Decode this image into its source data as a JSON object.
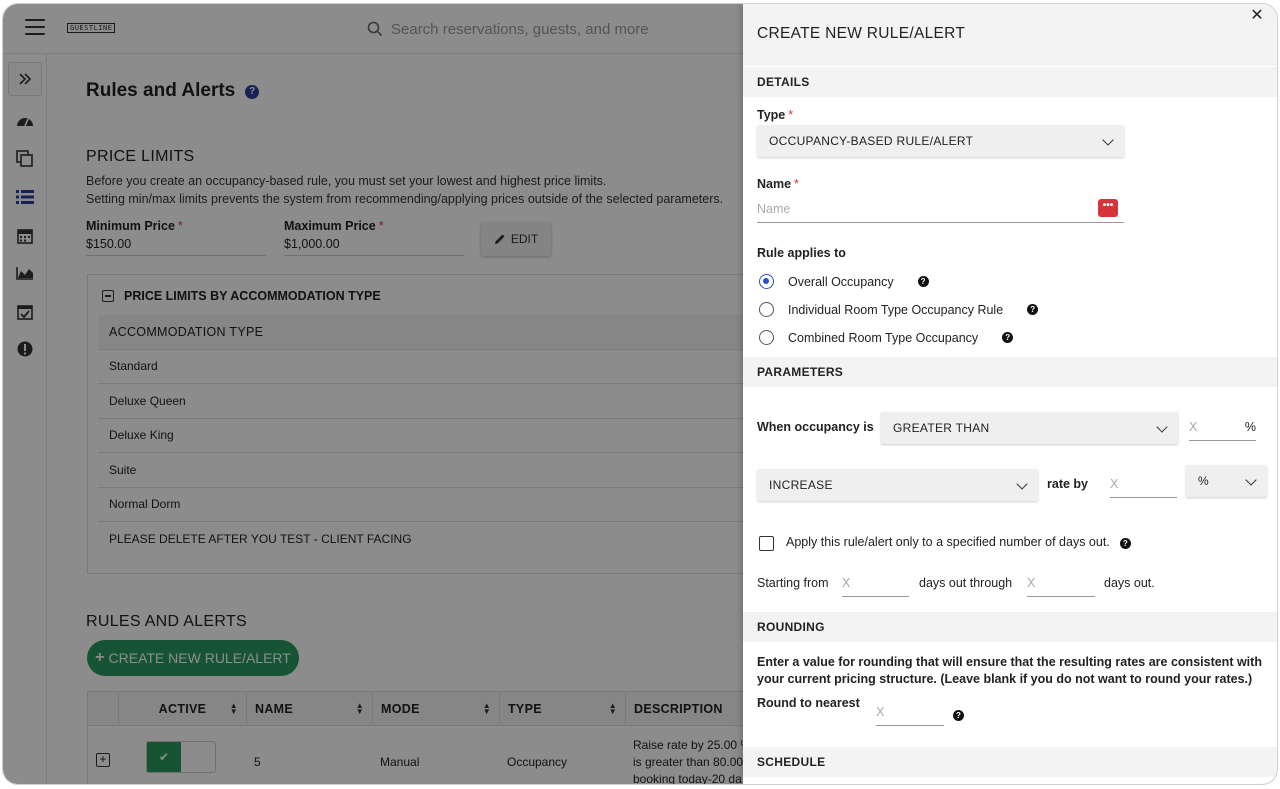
{
  "search": {
    "placeholder": "Search reservations, guests, and more"
  },
  "logo_text": "GUESTLINE",
  "page": {
    "title": "Rules and Alerts",
    "price_limits": {
      "title": "PRICE LIMITS",
      "desc1": "Before you create an occupancy-based rule, you must set your lowest and highest price limits.",
      "desc2": "Setting min/max limits prevents the system from recommending/applying prices outside of the selected parameters.",
      "min_label": "Minimum Price",
      "min_value": "$150.00",
      "max_label": "Maximum Price",
      "max_value": "$1,000.00",
      "edit_label": "EDIT",
      "by_type_title": "PRICE LIMITS BY ACCOMMODATION TYPE",
      "table_header": "ACCOMMODATION TYPE",
      "rows": [
        "Standard",
        "Deluxe Queen",
        "Deluxe King",
        "Suite",
        "Normal Dorm",
        "PLEASE DELETE AFTER YOU TEST - CLIENT FACING"
      ]
    },
    "rules": {
      "title": "RULES AND ALERTS",
      "create_label": "CREATE NEW RULE/ALERT",
      "columns": [
        "ACTIVE",
        "NAME",
        "MODE",
        "TYPE",
        "DESCRIPTION"
      ],
      "row": {
        "name": "5",
        "mode": "Manual",
        "type": "Occupancy",
        "desc1": "Raise rate by 25.00 %",
        "desc2": "is greater than 80.00",
        "desc3": "booking today-20 da"
      }
    }
  },
  "drawer": {
    "title": "CREATE NEW RULE/ALERT",
    "details_band": "DETAILS",
    "type_label": "Type",
    "type_value": "OCCUPANCY-BASED RULE/ALERT",
    "name_label": "Name",
    "name_placeholder": "Name",
    "applies_label": "Rule applies to",
    "applies_options": [
      "Overall Occupancy",
      "Individual Room Type Occupancy Rule",
      "Combined Room Type Occupancy"
    ],
    "applies_selected": 0,
    "parameters_band": "PARAMETERS",
    "when_label": "When occupancy is",
    "comparison_value": "GREATER THAN",
    "occupancy_placeholder": "X",
    "percent_sign": "%",
    "action_value": "INCREASE",
    "rate_by_label": "rate by",
    "rate_placeholder": "X",
    "unit_value": "%",
    "days_checkbox_label": "Apply this rule/alert only to a specified number of days out.",
    "starting_from_label": "Starting from",
    "start_placeholder": "X",
    "days_through_label": "days out through",
    "end_placeholder": "X",
    "days_out_label": "days out.",
    "rounding_band": "ROUNDING",
    "rounding_note": "Enter a value for rounding that will ensure that the resulting rates are consistent with your current pricing structure. (Leave blank if you do not want to round your rates.)",
    "round_label": "Round to nearest",
    "round_placeholder": "X",
    "schedule_band": "SCHEDULE"
  },
  "colors": {
    "accent_green": "#2a9a5f",
    "radio_blue": "#2b50c9",
    "help_blue": "#2b3d9c",
    "password_red": "#d9333a"
  },
  "icons": [
    "hamburger-icon",
    "search-icon",
    "expand-icon",
    "dashboard-icon",
    "copy-icon",
    "list-icon",
    "calendar-icon",
    "chart-icon",
    "calendar-check-icon",
    "alert-icon",
    "close-icon",
    "chevron-down-icon",
    "pencil-icon",
    "question-icon"
  ]
}
